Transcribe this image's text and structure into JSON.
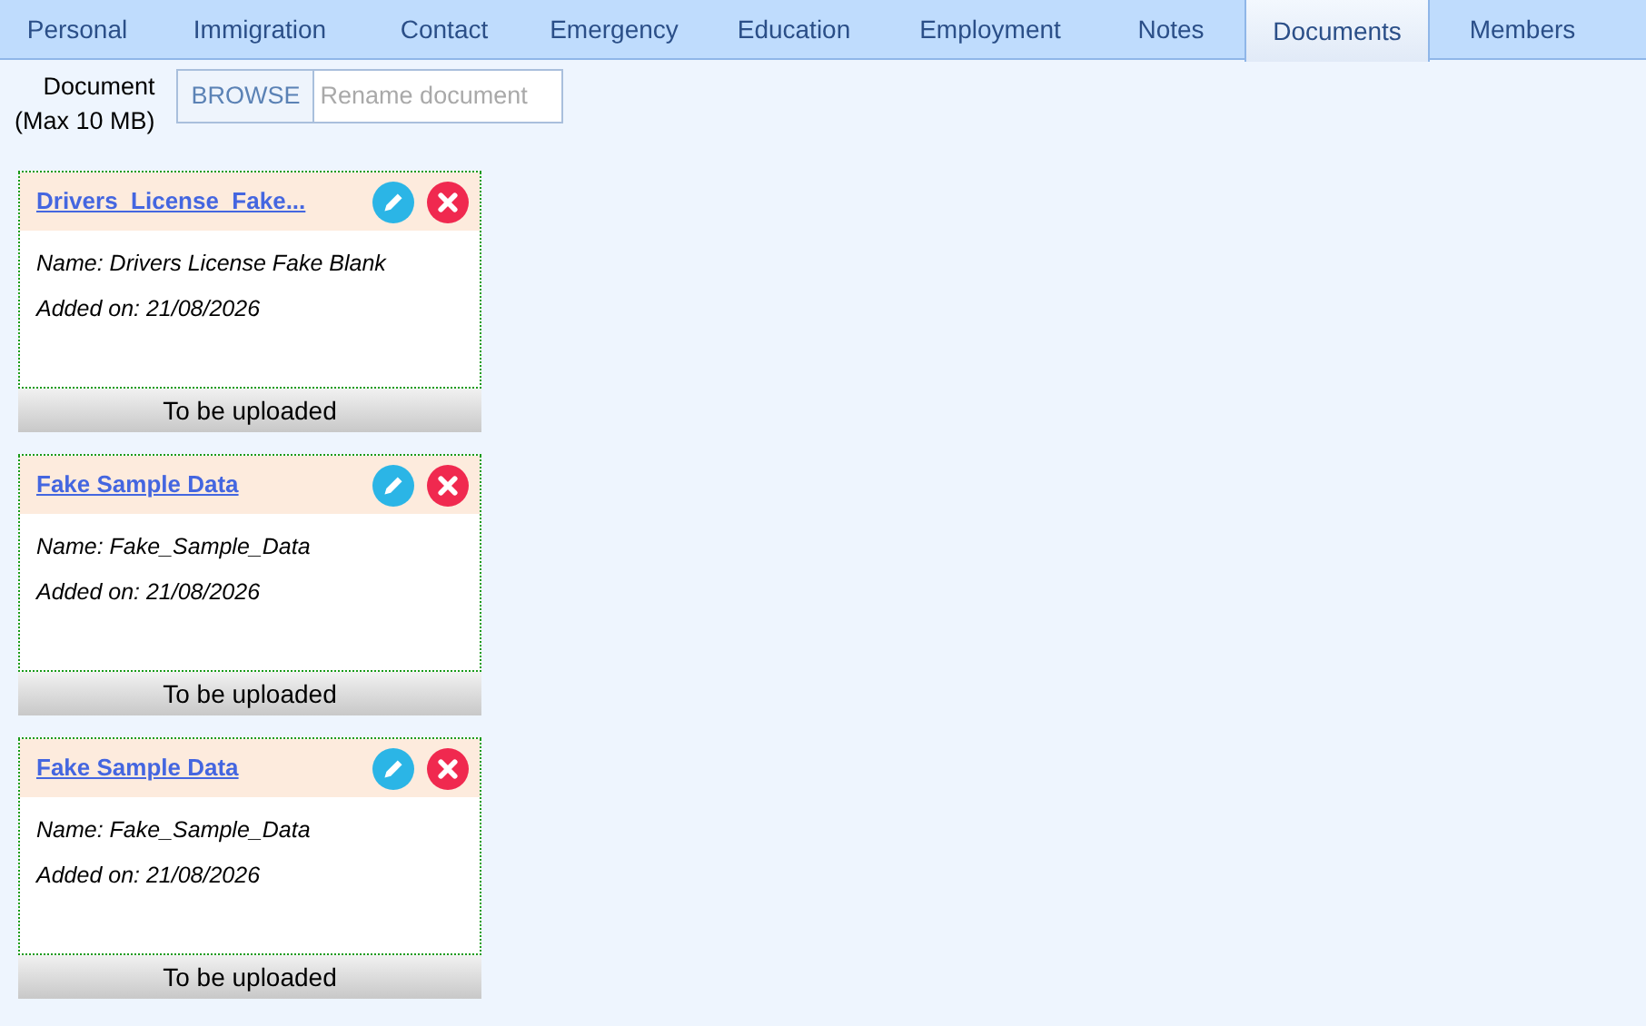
{
  "tabs": [
    {
      "label": "Personal",
      "selected": false
    },
    {
      "label": "Immigration",
      "selected": false
    },
    {
      "label": "Contact",
      "selected": false
    },
    {
      "label": "Emergency",
      "selected": false
    },
    {
      "label": "Education",
      "selected": false
    },
    {
      "label": "Employment",
      "selected": false
    },
    {
      "label": "Notes",
      "selected": false
    },
    {
      "label": "Documents",
      "selected": true
    },
    {
      "label": "Members",
      "selected": false
    }
  ],
  "upload": {
    "label": "Document",
    "hint": "(Max 10 MB)",
    "browse": "BROWSE",
    "placeholder": "Rename document"
  },
  "documents": [
    {
      "title": "Drivers_License_Fake...",
      "name": "Name: Drivers License Fake Blank",
      "added": "Added on: 21/08/2026",
      "status": "To be uploaded"
    },
    {
      "title": "Fake Sample Data",
      "name": "Name: Fake_Sample_Data",
      "added": "Added on: 21/08/2026",
      "status": "To be uploaded"
    },
    {
      "title": "Fake Sample Data",
      "name": "Name: Fake_Sample_Data",
      "added": "Added on: 21/08/2026",
      "status": "To be uploaded"
    }
  ]
}
